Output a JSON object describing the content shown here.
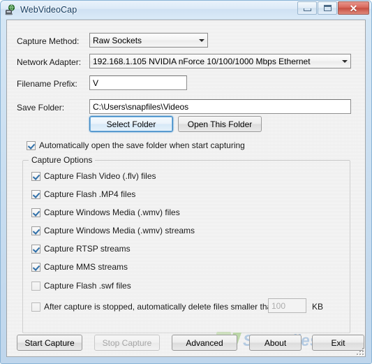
{
  "window": {
    "title": "WebVideoCap",
    "icon": "webcam-globe-icon",
    "controls": {
      "minimize": "Minimize",
      "maximize": "Maximize",
      "close": "Close"
    }
  },
  "form": {
    "capture_method": {
      "label": "Capture Method:",
      "value": "Raw Sockets"
    },
    "network_adapter": {
      "label": "Network Adapter:",
      "value": "192.168.1.105   NVIDIA nForce 10/100/1000 Mbps Ethernet"
    },
    "filename_prefix": {
      "label": "Filename Prefix:",
      "value": "V"
    },
    "save_folder": {
      "label": "Save Folder:",
      "value": "C:\\Users\\snapfiles\\Videos"
    },
    "select_folder_button": "Select Folder",
    "open_folder_button": "Open This Folder",
    "auto_open": {
      "label": "Automatically open the save folder when start capturing",
      "checked": true
    }
  },
  "capture_options": {
    "title": "Capture Options",
    "items": [
      {
        "label": "Capture Flash Video (.flv) files",
        "checked": true
      },
      {
        "label": "Capture Flash .MP4 files",
        "checked": true
      },
      {
        "label": "Capture Windows Media (.wmv) files",
        "checked": true
      },
      {
        "label": "Capture Windows Media (.wmv) streams",
        "checked": true
      },
      {
        "label": "Capture RTSP streams",
        "checked": true
      },
      {
        "label": "Capture MMS streams",
        "checked": true
      },
      {
        "label": "Capture Flash .swf files",
        "checked": false
      }
    ],
    "delete_small": {
      "label": "After capture is stopped, automatically delete files smaller than:",
      "checked": false,
      "size_value": "100",
      "unit": "KB"
    }
  },
  "footer": {
    "buttons": [
      {
        "label": "Start Capture",
        "disabled": false
      },
      {
        "label": "Stop Capture",
        "disabled": true
      },
      {
        "label": "Advanced",
        "disabled": false
      },
      {
        "label": "About",
        "disabled": false
      },
      {
        "label": "Exit",
        "disabled": false
      }
    ]
  },
  "watermark": {
    "text": "SnapFiles",
    "mark": "S"
  },
  "colors": {
    "accent": "#3d87c4",
    "titlebar": "#dceaf7",
    "close_button": "#d9685c",
    "client_bg": "#f1f1f1",
    "check": "#2f6fa8",
    "watermark_blue": "#8fb3d9",
    "watermark_green": "#b9d98f"
  }
}
